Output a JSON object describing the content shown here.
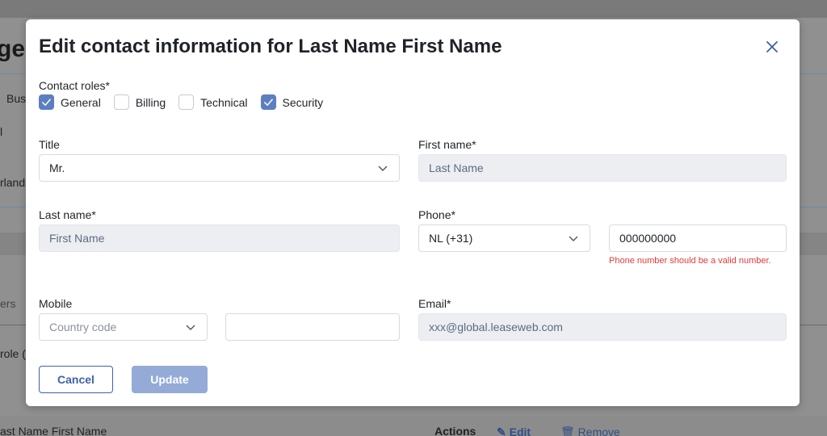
{
  "background": {
    "heading_fragment": "ge",
    "business_fragment": "Bus",
    "item_fragment": "l",
    "country_fragment": "rlands",
    "tab_fragment": "ers",
    "role_fragment": "role (",
    "bottom_name": "ast Name First Name",
    "actions_label": "Actions",
    "edit_label": "Edit",
    "remove_label": "Remove"
  },
  "modal": {
    "title": "Edit contact information for Last Name First Name",
    "close_icon": "close-icon",
    "contact_roles_label": "Contact roles*",
    "roles": [
      {
        "label": "General",
        "checked": true
      },
      {
        "label": "Billing",
        "checked": false
      },
      {
        "label": "Technical",
        "checked": false
      },
      {
        "label": "Security",
        "checked": true
      }
    ],
    "title_field": {
      "label": "Title",
      "value": "Mr."
    },
    "first_name": {
      "label": "First name*",
      "value": "Last Name"
    },
    "last_name": {
      "label": "Last name*",
      "value": "First Name"
    },
    "phone": {
      "label": "Phone*",
      "country_value": "NL (+31)",
      "number_value": "000000000",
      "error": "Phone number should be a valid number."
    },
    "mobile": {
      "label": "Mobile",
      "country_placeholder": "Country code",
      "number_value": ""
    },
    "email": {
      "label": "Email*",
      "value": "xxx@global.leaseweb.com"
    },
    "cancel_label": "Cancel",
    "update_label": "Update",
    "colors": {
      "accent": "#3c63a8",
      "checkbox_checked": "#5b7fc0",
      "update_disabled": "#93abd6",
      "error": "#e03a3a"
    }
  }
}
